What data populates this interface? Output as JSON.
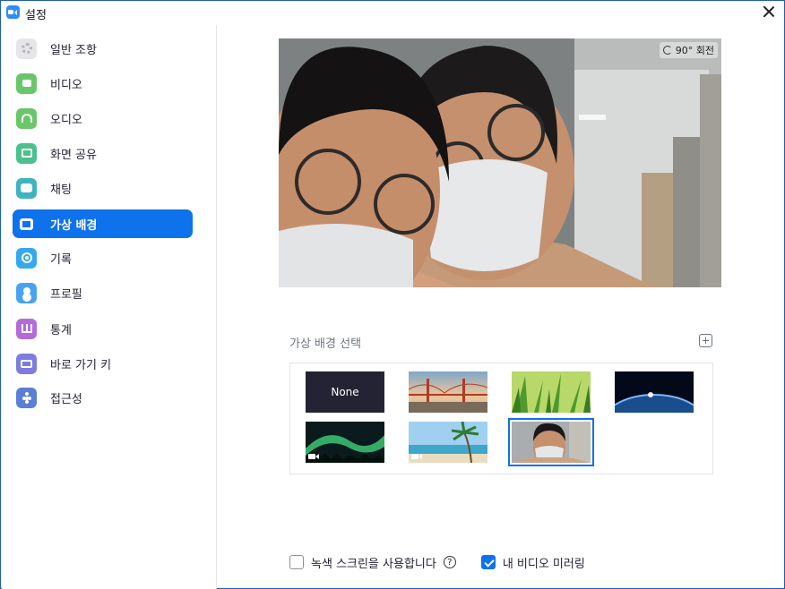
{
  "window": {
    "title": "설정"
  },
  "sidebar": {
    "items": [
      {
        "label": "일반 조항",
        "icon": "gear-icon"
      },
      {
        "label": "비디오",
        "icon": "video-camera-icon"
      },
      {
        "label": "오디오",
        "icon": "headphones-icon"
      },
      {
        "label": "화면 공유",
        "icon": "screen-share-icon"
      },
      {
        "label": "채팅",
        "icon": "chat-bubble-icon"
      },
      {
        "label": "가상 배경",
        "icon": "virtual-background-icon",
        "active": true
      },
      {
        "label": "기록",
        "icon": "record-icon"
      },
      {
        "label": "프로필",
        "icon": "profile-icon"
      },
      {
        "label": "통계",
        "icon": "statistics-icon"
      },
      {
        "label": "바로 가기 키",
        "icon": "keyboard-icon"
      },
      {
        "label": "접근성",
        "icon": "accessibility-icon"
      }
    ],
    "active_color": "#0e72ed"
  },
  "preview": {
    "rotate_label": "90° 회전"
  },
  "backgrounds": {
    "section_title": "가상 배경 선택",
    "items": [
      {
        "name": "none",
        "label": "None"
      },
      {
        "name": "golden-gate-bridge"
      },
      {
        "name": "grass"
      },
      {
        "name": "earth-from-space"
      },
      {
        "name": "aurora",
        "video": true
      },
      {
        "name": "beach",
        "video": true
      },
      {
        "name": "custom-office-photo",
        "selected": true
      }
    ]
  },
  "footer": {
    "green_screen_label": "녹색 스크린을 사용합니다",
    "green_screen_checked": false,
    "help_label": "?",
    "mirror_label": "내 비디오 미러링",
    "mirror_checked": true
  }
}
